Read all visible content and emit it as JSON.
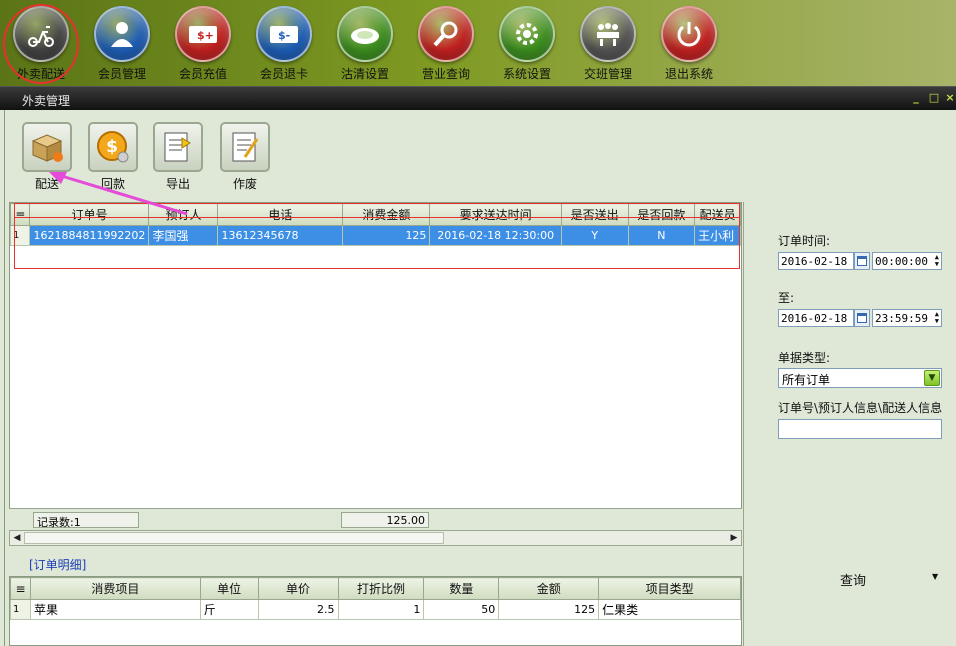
{
  "nav": [
    {
      "label": "外卖配送",
      "icon": "scooter-icon",
      "color": "#444444"
    },
    {
      "label": "会员管理",
      "icon": "person-icon",
      "color": "#1f5fb8"
    },
    {
      "label": "会员充值",
      "icon": "card-plus-icon",
      "color": "#c42222"
    },
    {
      "label": "会员退卡",
      "icon": "card-minus-icon",
      "color": "#1f5fb8"
    },
    {
      "label": "沽清设置",
      "icon": "plate-icon",
      "color": "#3d8f20"
    },
    {
      "label": "营业查询",
      "icon": "magnifier-icon",
      "color": "#c42222"
    },
    {
      "label": "系统设置",
      "icon": "gear-icon",
      "color": "#3d8f20"
    },
    {
      "label": "交班管理",
      "icon": "meeting-icon",
      "color": "#555555"
    },
    {
      "label": "退出系统",
      "icon": "power-icon",
      "color": "#c42222"
    }
  ],
  "window": {
    "title": "外卖管理",
    "min": "_",
    "max": "□",
    "close": "×"
  },
  "tools": [
    {
      "label": "配送",
      "icon": "box-icon"
    },
    {
      "label": "回款",
      "icon": "coin-icon"
    },
    {
      "label": "导出",
      "icon": "export-icon"
    },
    {
      "label": "作废",
      "icon": "void-icon"
    }
  ],
  "orders": {
    "columns": [
      "订单号",
      "预订人",
      "电话",
      "消费金额",
      "要求送达时间",
      "是否送出",
      "是否回款",
      "配送员"
    ],
    "rows": [
      {
        "num": "1",
        "order_no": "1621884811992202",
        "customer": "李国强",
        "phone": "13612345678",
        "amount": "125",
        "deliver_time": "2016-02-18 12:30:00",
        "sent": "Y",
        "paid": "N",
        "courier": "王小利"
      }
    ]
  },
  "summary": {
    "record_count": "记录数:1",
    "total": "125.00"
  },
  "detail": {
    "title": "[订单明细]",
    "columns": [
      "消费项目",
      "单位",
      "单价",
      "打折比例",
      "数量",
      "金额",
      "项目类型"
    ],
    "rows": [
      {
        "num": "1",
        "item": "苹果",
        "unit": "斤",
        "price": "2.5",
        "discount": "1",
        "qty": "50",
        "amount": "125",
        "type": "仁果类"
      }
    ]
  },
  "filter": {
    "order_time_label": "订单时间:",
    "from_date": "2016-02-18",
    "from_time": "00:00:00",
    "to_label": "至:",
    "to_date": "2016-02-18",
    "to_time": "23:59:59",
    "type_label": "单据类型:",
    "type_value": "所有订单",
    "search_label": "订单号\\预订人信息\\配送人信息",
    "search_value": "",
    "query_label": "查询"
  }
}
